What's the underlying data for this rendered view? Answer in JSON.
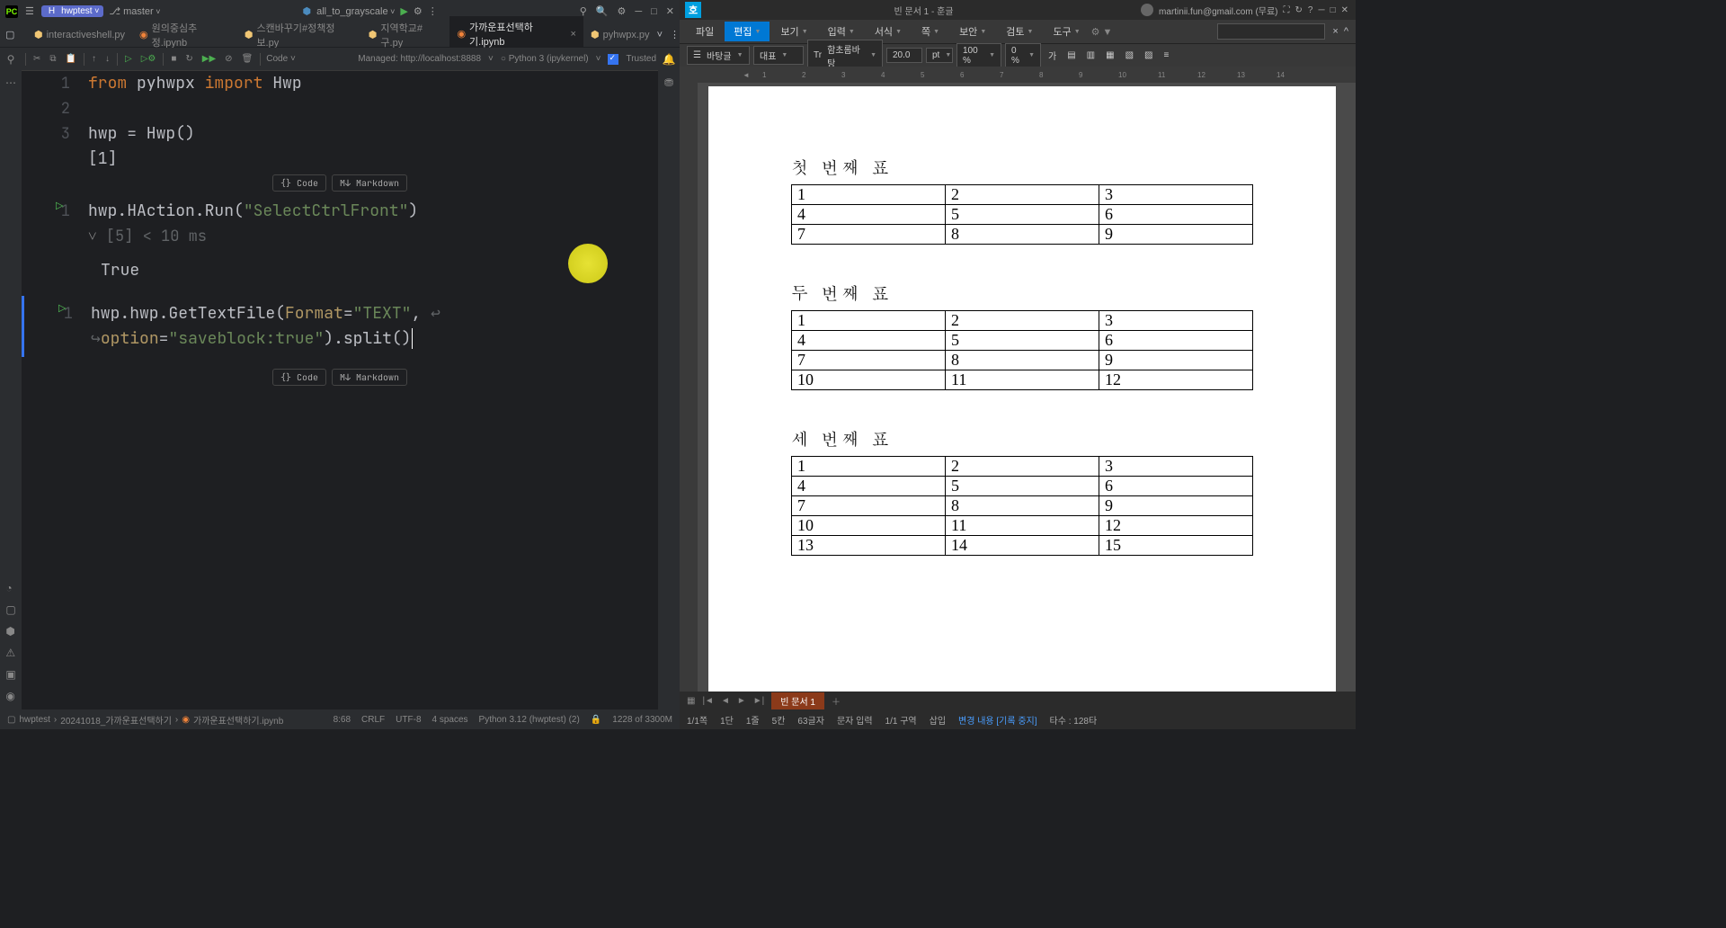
{
  "pycharm": {
    "titlebar": {
      "project": "hwptest",
      "branch": "master",
      "run_config": "all_to_grayscale"
    },
    "tabs": [
      {
        "name": "interactiveshell.py",
        "type": "py"
      },
      {
        "name": "원의중심추정.ipynb",
        "type": "nb"
      },
      {
        "name": "스캔바꾸기#정책정보.py",
        "type": "py"
      },
      {
        "name": "지역학교#구.py",
        "type": "py"
      },
      {
        "name": "가까운표선택하기.ipynb",
        "type": "nb",
        "active": true
      },
      {
        "name": "pyhwpx.py",
        "type": "py"
      }
    ],
    "toolbar": {
      "code_label": "Code",
      "server": "Managed: http://localhost:8888",
      "kernel": "Python 3 (ipykernel)",
      "trusted": "Trusted"
    },
    "cells": {
      "cell1_lines": [
        "1",
        "2",
        "3"
      ],
      "cell1_code_l1_kw1": "from",
      "cell1_code_l1_mod": " pyhwpx ",
      "cell1_code_l1_kw2": "import",
      "cell1_code_l1_name": " Hwp",
      "cell1_code_l3": "hwp = Hwp()",
      "cell1_out": "[1]",
      "add_code": "Code",
      "add_md": "Markdown",
      "cell2_line": "1",
      "cell2_prefix": "hwp.HAction.Run(",
      "cell2_str": "\"SelectCtrlFront\"",
      "cell2_suffix": ")",
      "cell2_exec": "[5]  <  10 ms",
      "cell2_out": "True",
      "cell3_line": "1",
      "cell3_prefix": "hwp.hwp.GetTextFile(",
      "cell3_param1": "Format",
      "cell3_eq1": "=",
      "cell3_str1": "\"TEXT\"",
      "cell3_comma": ", ",
      "cell3_wrap": "↩",
      "cell3_cont": "↪",
      "cell3_param2": "option",
      "cell3_eq2": "=",
      "cell3_str2": "\"saveblock:true\"",
      "cell3_suffix": ").split()"
    },
    "status": {
      "crumb1": "hwptest",
      "crumb2": "20241018_가까운표선택하기",
      "crumb3": "가까운표선택하기.ipynb",
      "pos": "8:68",
      "eol": "CRLF",
      "enc": "UTF-8",
      "indent": "4 spaces",
      "interp": "Python 3.12 (hwptest) (2)",
      "mem": "1228 of 3300M"
    }
  },
  "hangul": {
    "title": "빈 문서 1 - 훈글",
    "user": "martinii.fun@gmail.com (무료)",
    "menu": [
      "파일",
      "편집",
      "보기",
      "입력",
      "서식",
      "쪽",
      "보안",
      "검토",
      "도구"
    ],
    "format": {
      "style": "바탕글",
      "parastyle": "대표",
      "font": "함초롬바탕",
      "size": "20.0",
      "unit": "pt",
      "zoom": "100 %",
      "extra": "0 %",
      "ga": "가"
    },
    "ruler_ticks": [
      "1",
      "2",
      "3",
      "4",
      "5",
      "6",
      "7",
      "8",
      "9",
      "10",
      "11",
      "12",
      "13",
      "14"
    ],
    "doc": {
      "h1": "첫 번째 표",
      "t1": [
        [
          "1",
          "2",
          "3"
        ],
        [
          "4",
          "5",
          "6"
        ],
        [
          "7",
          "8",
          "9"
        ]
      ],
      "h2": "두 번째 표",
      "t2": [
        [
          "1",
          "2",
          "3"
        ],
        [
          "4",
          "5",
          "6"
        ],
        [
          "7",
          "8",
          "9"
        ],
        [
          "10",
          "11",
          "12"
        ]
      ],
      "h3": "세 번째 표",
      "t3": [
        [
          "1",
          "2",
          "3"
        ],
        [
          "4",
          "5",
          "6"
        ],
        [
          "7",
          "8",
          "9"
        ],
        [
          "10",
          "11",
          "12"
        ],
        [
          "13",
          "14",
          "15"
        ]
      ]
    },
    "doctab": "빈 문서 1",
    "status": {
      "page": "1/1쪽",
      "dan": "1단",
      "line": "1줄",
      "col": "5칸",
      "chars": "63글자",
      "mode": "문자 입력",
      "section": "1/1 구역",
      "insert": "삽입",
      "track": "변경 내용 [기록 중지]",
      "typed": "타수 : 128타"
    }
  }
}
